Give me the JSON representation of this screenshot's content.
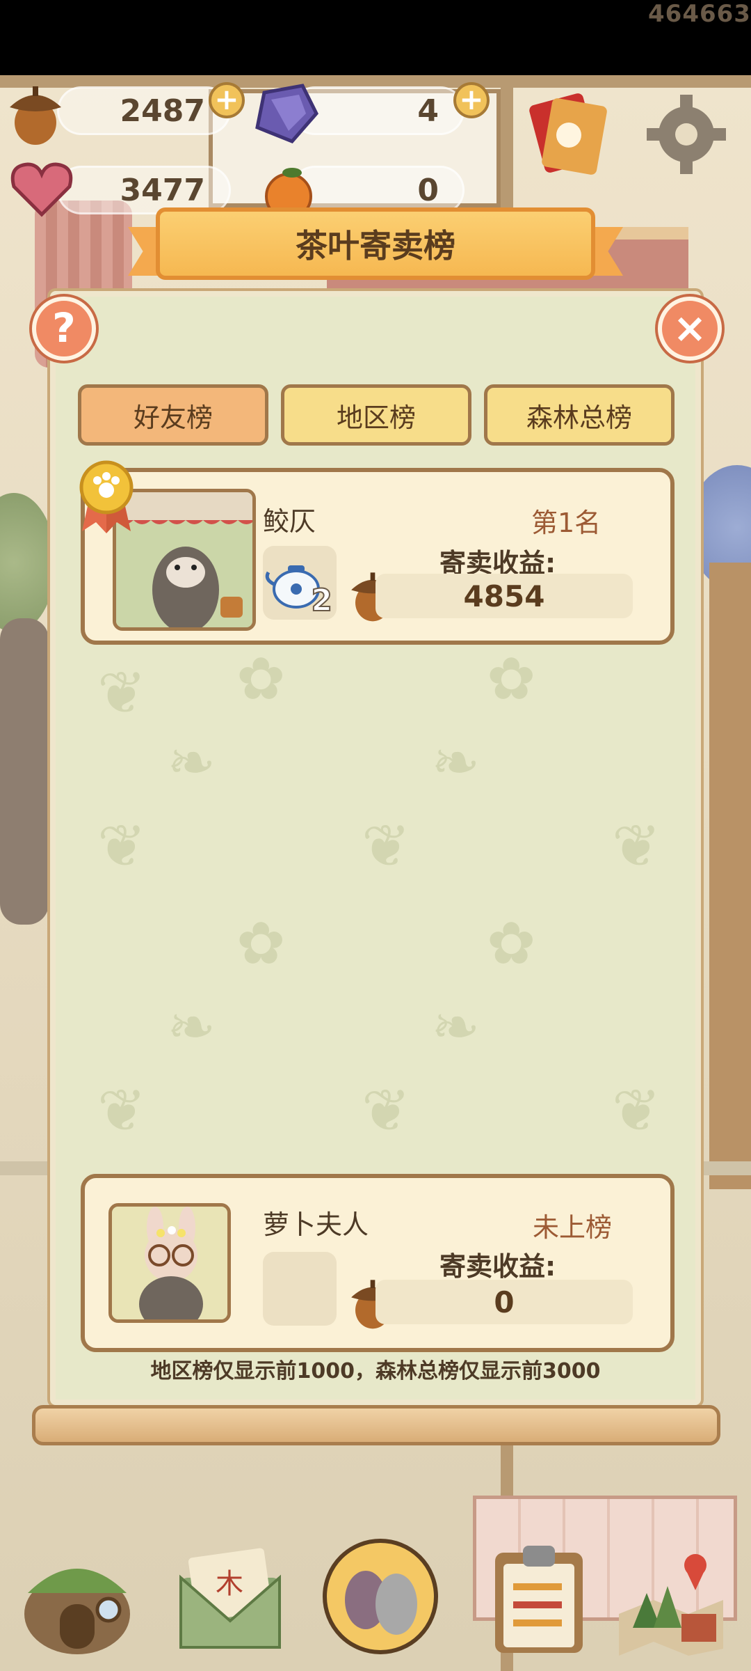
{
  "player_id": "464663",
  "currencies": {
    "acorn": {
      "value": "2487",
      "icon": "acorn-icon"
    },
    "gem": {
      "value": "4",
      "icon": "gem-icon"
    },
    "heart": {
      "value": "3477",
      "icon": "heart-icon"
    },
    "orange": {
      "value": "0",
      "icon": "orange-icon"
    }
  },
  "plus_symbol": "+",
  "panel": {
    "title": "茶叶寄卖榜",
    "help_symbol": "?",
    "close_symbol": "×"
  },
  "tabs": [
    {
      "label": "好友榜",
      "active": true
    },
    {
      "label": "地区榜",
      "active": false
    },
    {
      "label": "森林总榜",
      "active": false
    }
  ],
  "entries": [
    {
      "name": "鲛仄",
      "rank": "第1名",
      "earnings_label": "寄卖收益:",
      "earnings": "4854",
      "item_count": "2"
    }
  ],
  "my_entry": {
    "name": "萝卜夫人",
    "rank": "未上榜",
    "earnings_label": "寄卖收益:",
    "earnings": "0"
  },
  "footnote": "地区榜仅显示前1000，森林总榜仅显示前3000",
  "colors": {
    "accent": "#f6b851",
    "tab_active": "#f3b77a",
    "tab": "#f7dd8a",
    "close": "#f08a64"
  },
  "bottom_nav": [
    "home-icon",
    "mail-icon",
    "bird-shop-icon",
    "clipboard-icon",
    "map-icon"
  ]
}
